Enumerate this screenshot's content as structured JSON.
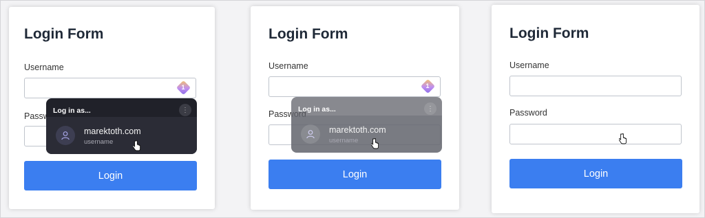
{
  "panels": [
    {
      "title": "Login Form",
      "username_label": "Username",
      "password_label": "Password",
      "password_label_visible": "Passwo",
      "login_label": "Login",
      "badge_count": "1",
      "popup": {
        "header": "Log in as...",
        "menu_icon": "kebab-menu-icon",
        "account_name": "marektoth.com",
        "account_sub": "username"
      }
    },
    {
      "title": "Login Form",
      "username_label": "Username",
      "password_label": "Password",
      "login_label": "Login",
      "badge_count": "1",
      "popup": {
        "header": "Log in as...",
        "menu_icon": "kebab-menu-icon",
        "account_name": "marektoth.com",
        "account_sub": "username"
      }
    },
    {
      "title": "Login Form",
      "username_label": "Username",
      "password_label": "Password",
      "login_label": "Login"
    }
  ],
  "colors": {
    "primary_button": "#3b7ef0",
    "popup_bg": "#202129"
  }
}
